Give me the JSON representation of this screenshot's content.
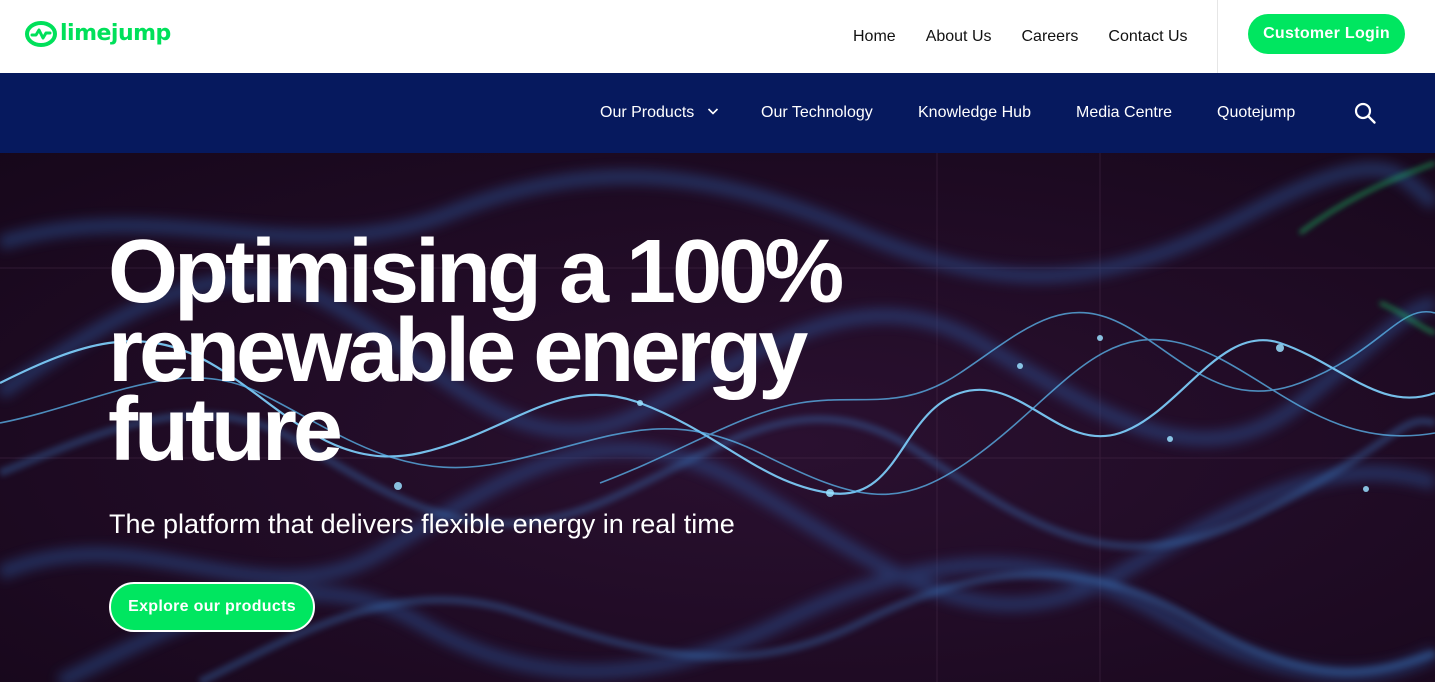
{
  "brand": {
    "name": "limejump",
    "accent_color": "#00e660",
    "nav_color": "#06195e"
  },
  "top_nav": {
    "links": [
      "Home",
      "About Us",
      "Careers",
      "Contact Us"
    ],
    "login_label": "Customer Login"
  },
  "main_nav": {
    "items": [
      "Our Products",
      "Our Technology",
      "Knowledge Hub",
      "Media Centre",
      "Quotejump"
    ],
    "products_icon": "chevron-down-icon",
    "search_icon": "search-icon"
  },
  "hero": {
    "headline_lines": [
      "Optimising a 100%",
      "renewable energy",
      "future"
    ],
    "subtitle": "The platform that delivers flexible energy in real time",
    "cta_label": "Explore our products"
  }
}
